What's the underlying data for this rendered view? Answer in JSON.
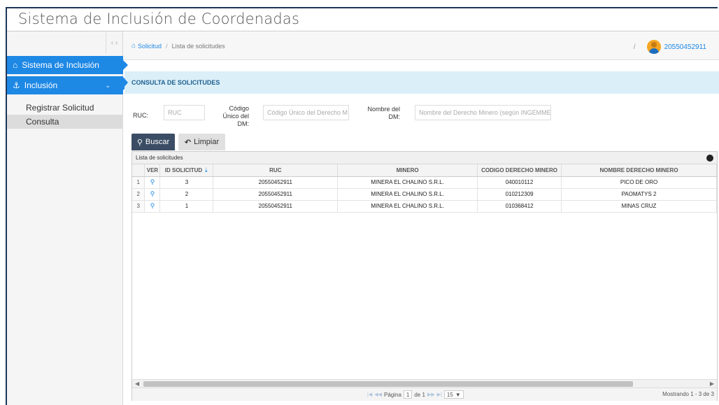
{
  "app": {
    "title": "Sistema de Inclusión de Coordenadas"
  },
  "sidebar": {
    "toggle": "‹ ›",
    "items": [
      {
        "label": "Sistema de Inclusión",
        "icon": "home-icon"
      },
      {
        "label": "Inclusión",
        "icon": "anchor-icon"
      }
    ],
    "subitems": [
      {
        "label": "Registrar Solicitud"
      },
      {
        "label": "Consulta"
      }
    ]
  },
  "breadcrumb": {
    "link": "Solicitud",
    "separator": "/",
    "current": "Lista de solicitudes"
  },
  "user": {
    "separator": "/",
    "name": "20550452911"
  },
  "section": {
    "title": "CONSULTA DE SOLICITUDES"
  },
  "form": {
    "ruc_label": "RUC:",
    "ruc_placeholder": "RUC",
    "codigo_label_1": "Código",
    "codigo_label_2": "Único del",
    "codigo_label_3": "DM:",
    "codigo_placeholder": "Código Único del Derecho M",
    "nombre_label_1": "Nombre del",
    "nombre_label_2": "DM:",
    "nombre_placeholder": "Nombre del Derecho Minero (según INGEMMET)",
    "search_label": "Buscar",
    "clear_label": "Limpiar"
  },
  "grid": {
    "caption": "Lista de solicitudes",
    "columns": [
      "",
      "VER",
      "ID SOLICITUD",
      "RUC",
      "MINERO",
      "CODIGO DERECHO MINERO",
      "NOMBRE DERECHO MINERO"
    ],
    "rows": [
      {
        "n": "1",
        "id": "3",
        "ruc": "20550452911",
        "minero": "MINERA EL CHALINO S.R.L.",
        "codigo": "040010112",
        "nombre": "PICO DE ORO"
      },
      {
        "n": "2",
        "id": "2",
        "ruc": "20550452911",
        "minero": "MINERA EL CHALINO S.R.L.",
        "codigo": "010212309",
        "nombre": "PAOMATYS 2"
      },
      {
        "n": "3",
        "id": "1",
        "ruc": "20550452911",
        "minero": "MINERA EL CHALINO S.R.L.",
        "codigo": "010368412",
        "nombre": "MINAS CRUZ"
      }
    ],
    "pager": {
      "page_label": "Página",
      "page_value": "1",
      "of_label": "de 1",
      "rows_per_page": "15",
      "info": "Mostrando 1 - 3 de 3"
    }
  }
}
